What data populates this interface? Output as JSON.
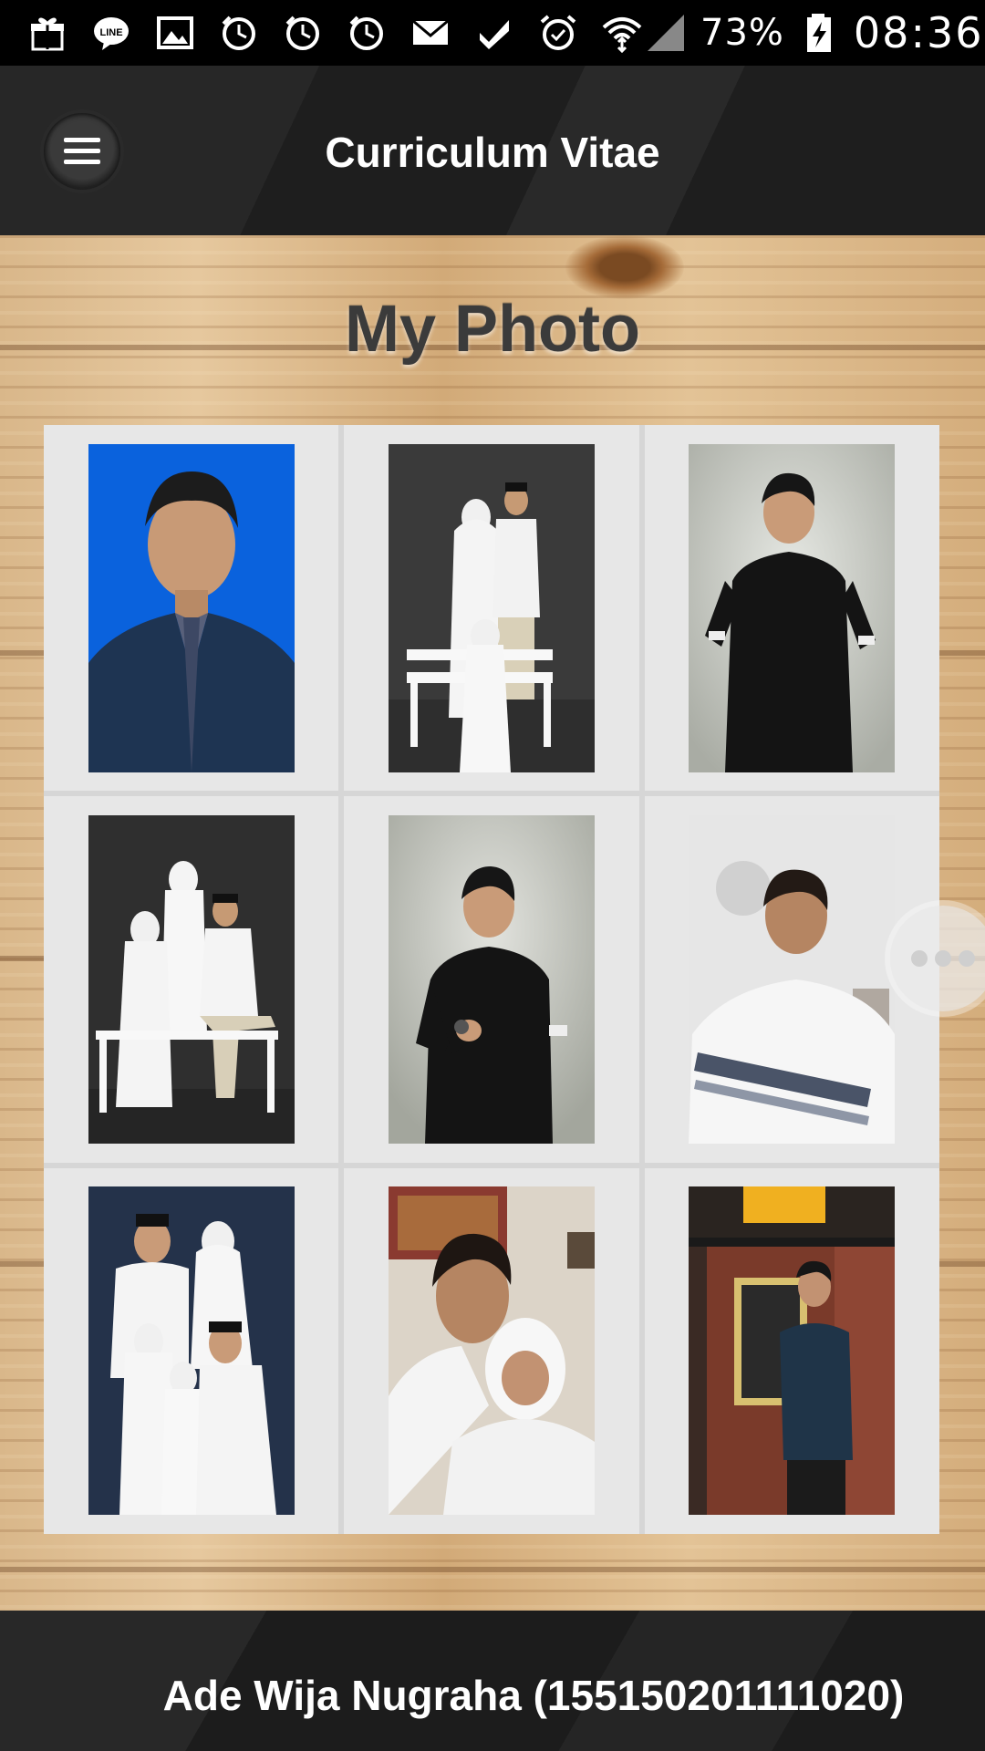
{
  "status_bar": {
    "icons": [
      "gift-icon",
      "line-icon",
      "image-icon",
      "alarm-clock-icon",
      "alarm-clock-icon",
      "alarm-clock-icon",
      "mail-icon",
      "task-check-icon",
      "alarm-icon",
      "wifi-icon",
      "signal-icon",
      "battery-charging-icon"
    ],
    "battery": "73%",
    "time": "08:36"
  },
  "app_bar": {
    "title": "Curriculum Vitae",
    "menu_icon": "hamburger-menu-icon"
  },
  "page": {
    "heading": "My Photo"
  },
  "gallery": {
    "photos": [
      {
        "subject": "formal portrait, blue background, dark suit",
        "bg": "#0a62dd"
      },
      {
        "subject": "family in white clothing on bench, dark studio",
        "bg": "#3a3a3a"
      },
      {
        "subject": "man in black shirt, hands in pockets, light studio",
        "bg": "#c9ccc6"
      },
      {
        "subject": "family seated on white bench, dark studio",
        "bg": "#2f2f2f"
      },
      {
        "subject": "man in black shirt checking watch",
        "bg": "#c2c4bd"
      },
      {
        "subject": "selfie in white striped shirt indoors",
        "bg": "#e4e4e4"
      },
      {
        "subject": "family portrait in white, dark blue background",
        "bg": "#24324a"
      },
      {
        "subject": "selfie with girl in white hijab",
        "bg": "#d8d0c4"
      },
      {
        "subject": "man with glasses beside brick wall",
        "bg": "#7a3a2a"
      }
    ]
  },
  "footer": {
    "text": "Ade Wija Nugraha (155150201111020)"
  },
  "colors": {
    "bar": "#1e1e1e",
    "wood": "#dcb98b",
    "title_text": "#3b3b3b",
    "cell_bg": "#e7e7e7"
  }
}
